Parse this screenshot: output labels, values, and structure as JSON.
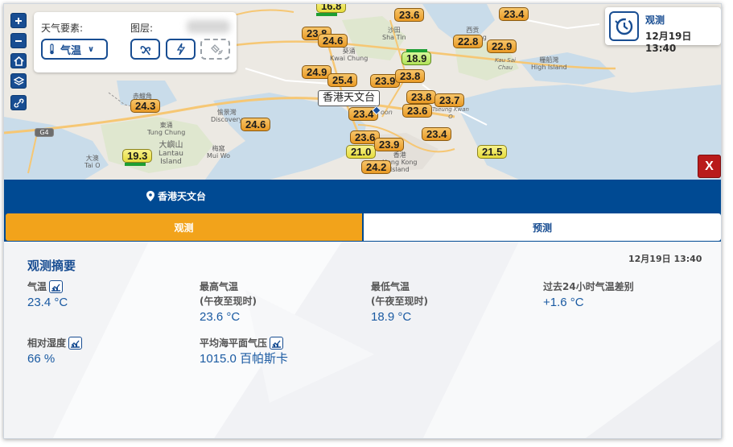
{
  "map": {
    "panel": {
      "element_label": "天气要素:",
      "element_value": "气温",
      "layer_label": "图层:"
    },
    "station_label": "香港天文台",
    "temps": [
      {
        "v": "16.8"
      },
      {
        "v": "23.6"
      },
      {
        "v": "23.4"
      },
      {
        "v": "23.8"
      },
      {
        "v": "24.6"
      },
      {
        "v": "22.8"
      },
      {
        "v": "22.9"
      },
      {
        "v": "18.9"
      },
      {
        "v": "24.9"
      },
      {
        "v": "25.4"
      },
      {
        "v": "23.9"
      },
      {
        "v": "23.8"
      },
      {
        "v": "24.3"
      },
      {
        "v": "23.8"
      },
      {
        "v": "23.7"
      },
      {
        "v": "23.4"
      },
      {
        "v": "23.6"
      },
      {
        "v": "24.6"
      },
      {
        "v": "23.4"
      },
      {
        "v": "23.6"
      },
      {
        "v": "21.0"
      },
      {
        "v": "23.9"
      },
      {
        "v": "21.5"
      },
      {
        "v": "19.3"
      },
      {
        "v": "24.2"
      }
    ],
    "places": {
      "kwai_chung_zh": "葵涌",
      "kwai_chung_en": "Kwai Chung",
      "shatin_zh": "沙田",
      "shatin_en": "Sha Tin",
      "saikung_zh": "西贡",
      "saikung_en": "Sai Kung",
      "kausai_en": "Kau Sai\nChau",
      "highisland_zh": "糧船灣",
      "highisland_en": "High Island",
      "tungchung_zh": "東涌",
      "tungchung_en": "Tung Chung",
      "lantau_zh": "大嶼山",
      "lantau_en": "Lantau\nIsland",
      "discovery_zh": "愉景灣",
      "discovery_en": "Discovery",
      "muiwo_zh": "梅窩",
      "muiwo_en": "Mui Wo",
      "taio_zh": "大澳",
      "taio_en": "Tai O",
      "chekkok_zh": "赤鱲角",
      "kowloon_en": "oon",
      "tkw_en": "Tseung Kwan\nO",
      "hk_zh": "香港",
      "hk_en": "Hong Kong\nIsland",
      "road_g4": "G4"
    }
  },
  "obs_card": {
    "title": "观测",
    "datetime": "12月19日 13:40"
  },
  "close_label": "X",
  "station_bar": {
    "name": "香港天文台"
  },
  "tabs": [
    {
      "label": "观测"
    },
    {
      "label": "预测"
    }
  ],
  "summary": {
    "title": "观测摘要",
    "time": "12月19日 13:40",
    "items": [
      {
        "label": "气温",
        "sub": "",
        "value": "23.4 °C"
      },
      {
        "label": "最高气温",
        "sub": "(午夜至现时)",
        "value": "23.6 °C"
      },
      {
        "label": "最低气温",
        "sub": "(午夜至现时)",
        "value": "18.9 °C"
      },
      {
        "label": "过去24小时气温差别",
        "sub": "",
        "value": "+1.6 °C"
      },
      {
        "label": "相对湿度",
        "sub": "",
        "value": "66 %"
      },
      {
        "label": "平均海平面气压",
        "sub": "",
        "value": "1015.0 百帕斯卡"
      }
    ]
  },
  "colors": {
    "brand_blue": "#004a93",
    "tab_active": "#f2a31b",
    "close_red": "#b91b1b",
    "value_blue": "#1a5aa2"
  }
}
